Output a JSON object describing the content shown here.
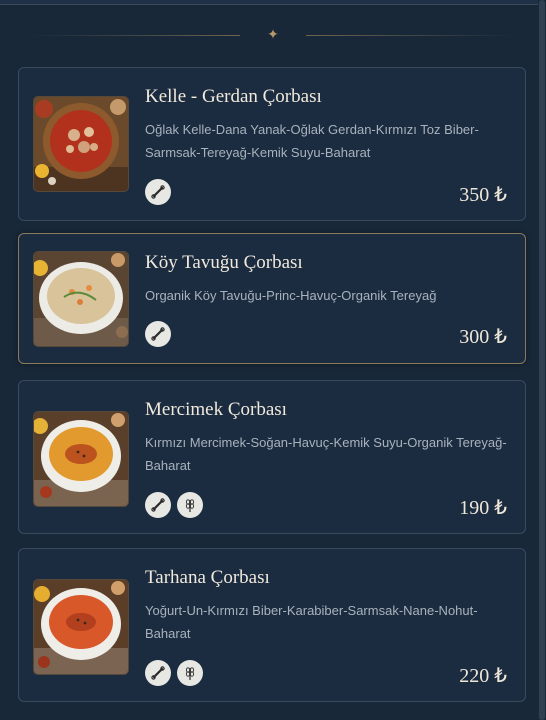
{
  "menu": {
    "items": [
      {
        "name": "Kelle - Gerdan Çorbası",
        "description": "Oğlak Kelle-Dana Yanak-Oğlak Gerdan-Kırmızı Toz Biber-Sarmsak-Tereyağ-Kemik Suyu-Baharat",
        "price": "350 ₺",
        "icons": [
          "bone-icon"
        ]
      },
      {
        "name": "Köy Tavuğu Çorbası",
        "description": "Organik Köy Tavuğu-Princ-Havuç-Organik Tereyağ",
        "price": "300 ₺",
        "icons": [
          "bone-icon"
        ]
      },
      {
        "name": "Mercimek Çorbası",
        "description": "Kırmızı Mercimek-Soğan-Havuç-Kemik Suyu-Organik Tereyağ-Baharat",
        "price": "190 ₺",
        "icons": [
          "bone-icon",
          "wheat-icon"
        ]
      },
      {
        "name": "Tarhana Çorbası",
        "description": "Yoğurt-Un-Kırmızı Biber-Karabiber-Sarmsak-Nane-Nohut-Baharat",
        "price": "220 ₺",
        "icons": [
          "bone-icon",
          "wheat-icon"
        ]
      }
    ]
  },
  "colors": {
    "background": "#182839",
    "card": "#1b2c40",
    "accent_gold": "#b79668",
    "text_muted": "#a9b2bc"
  }
}
